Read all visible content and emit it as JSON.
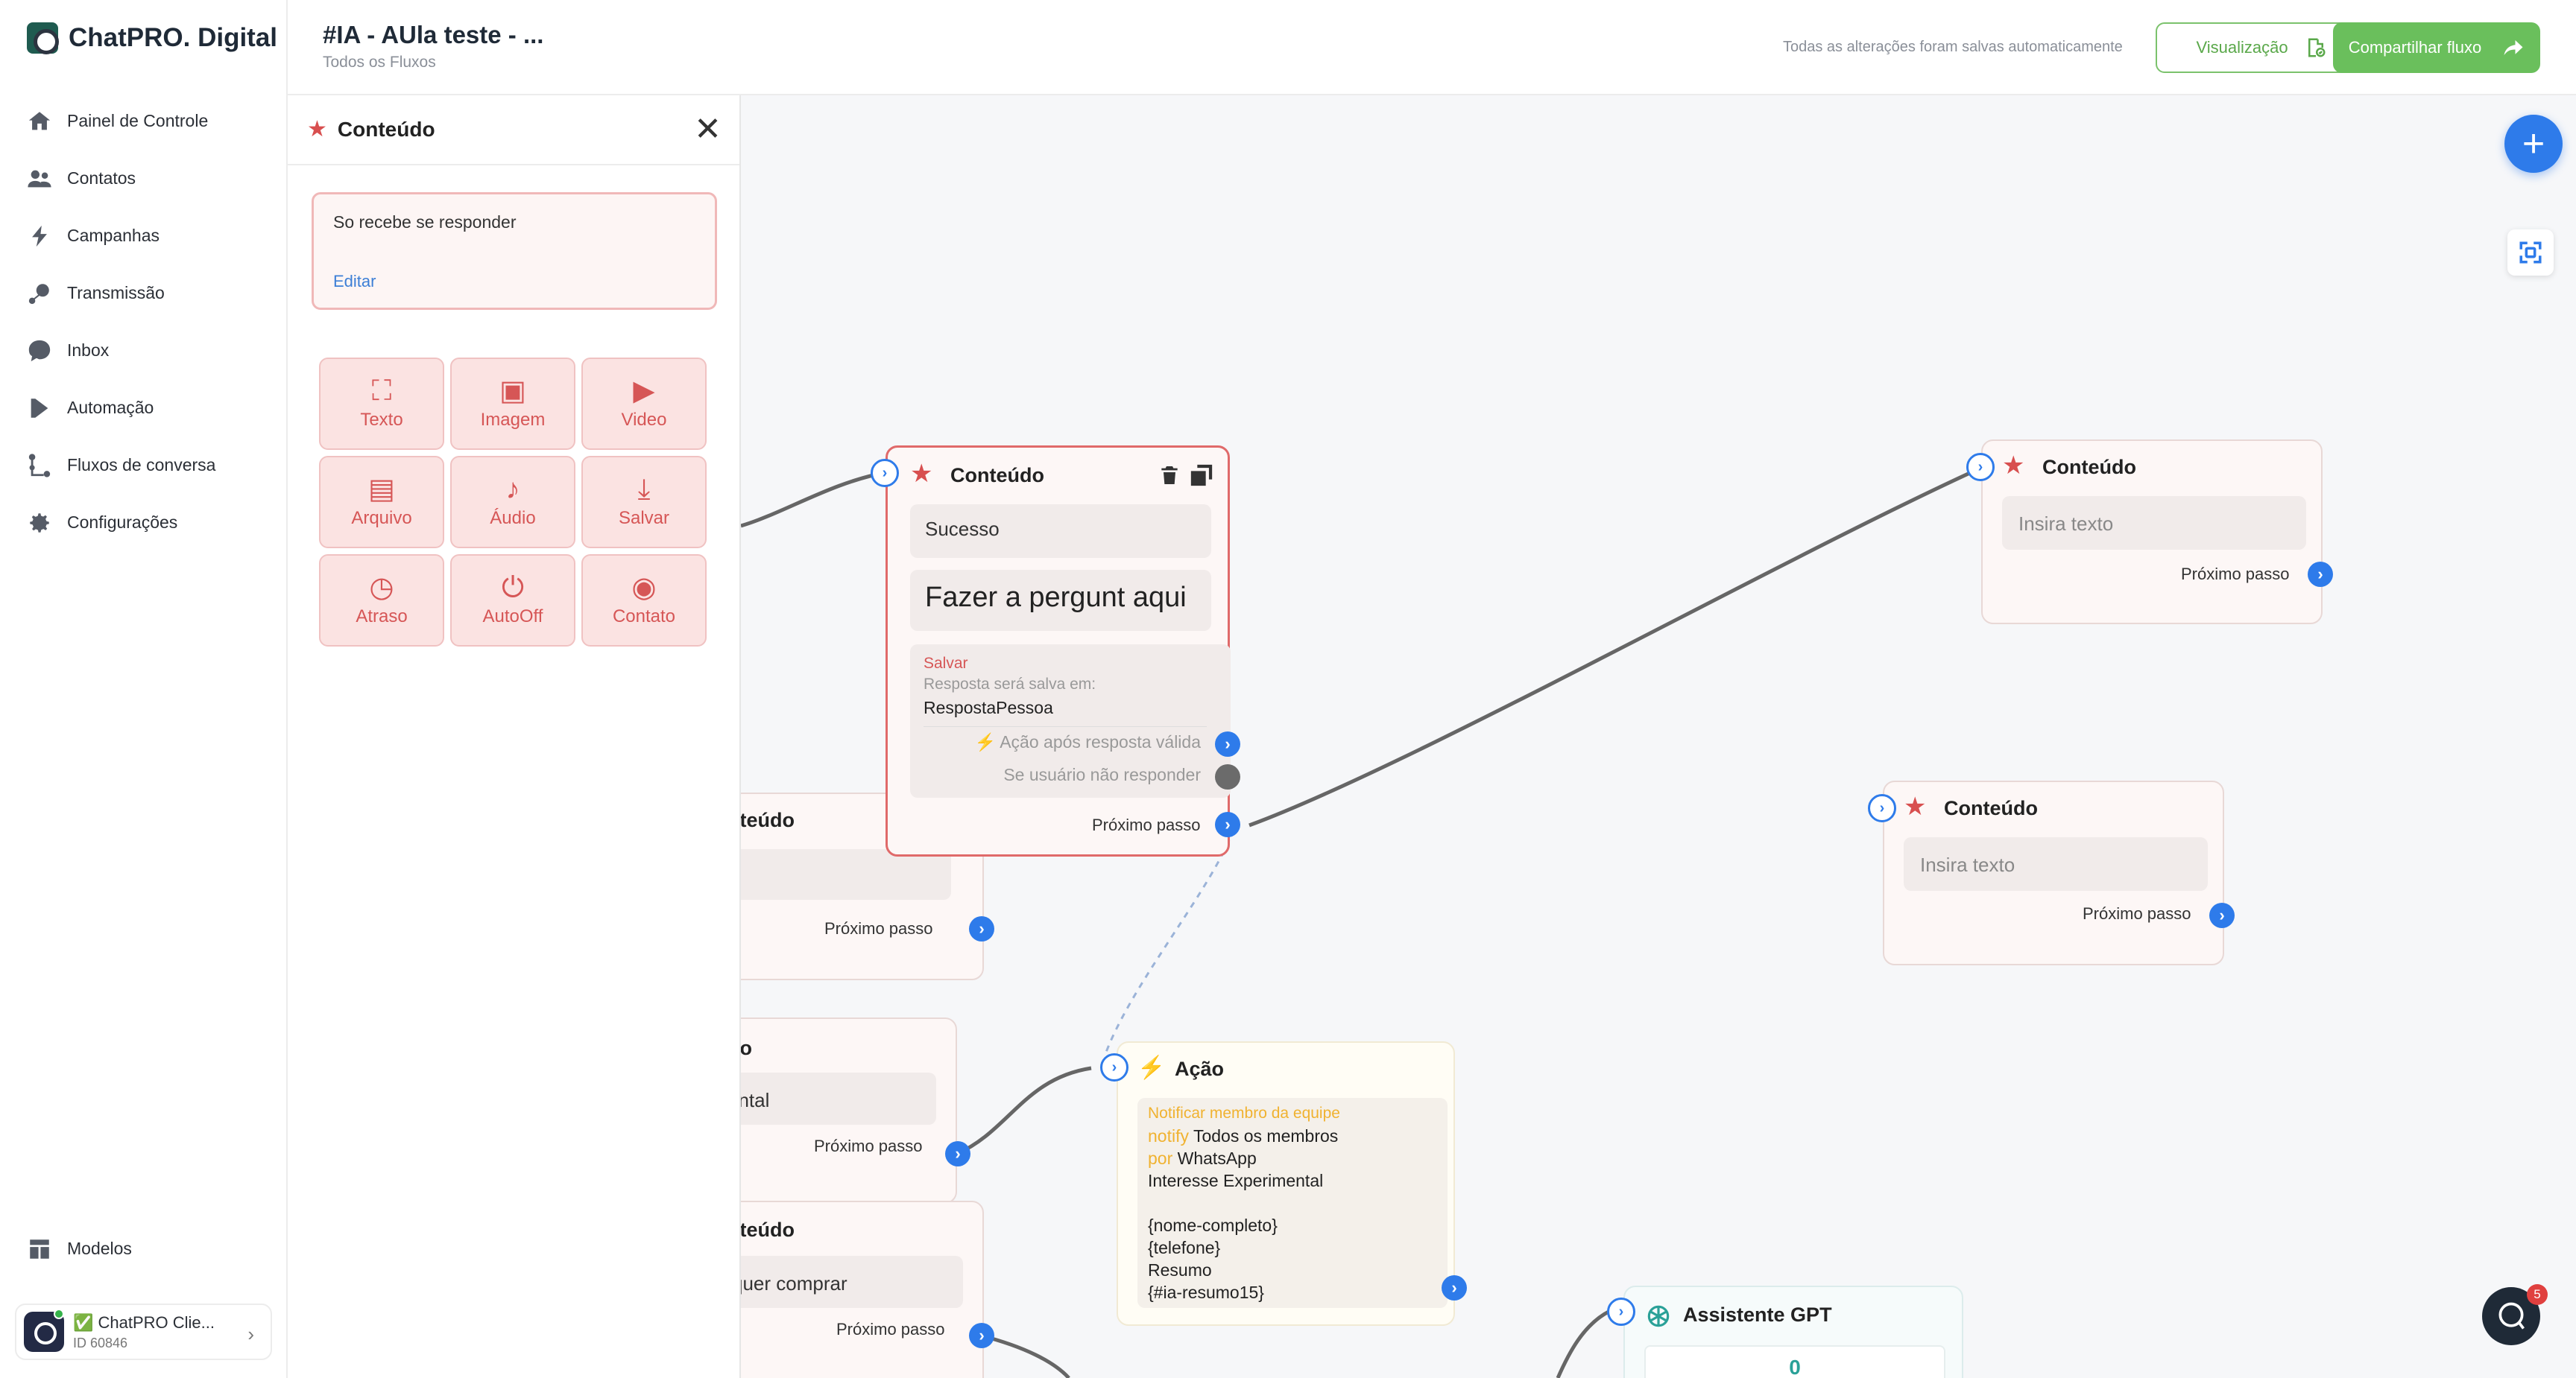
{
  "brand": {
    "name": "ChatPRO. Digital"
  },
  "nav": {
    "items": [
      {
        "label": "Painel de Controle",
        "icon": "home-icon"
      },
      {
        "label": "Contatos",
        "icon": "users-icon"
      },
      {
        "label": "Campanhas",
        "icon": "bolt-icon"
      },
      {
        "label": "Transmissão",
        "icon": "broadcast-icon"
      },
      {
        "label": "Inbox",
        "icon": "chat-icon"
      },
      {
        "label": "Automação",
        "icon": "play-icon"
      },
      {
        "label": "Fluxos de conversa",
        "icon": "flow-icon"
      },
      {
        "label": "Configurações",
        "icon": "gear-icon"
      }
    ],
    "bottom": {
      "label": "Modelos",
      "icon": "templates-icon"
    }
  },
  "account": {
    "name": "✅ ChatPRO Clie...",
    "id": "ID 60846"
  },
  "header": {
    "title": "#IA - AUla teste - ...",
    "breadcrumb": "Todos os Fluxos",
    "autosave": "Todas as alterações foram salvas automaticamente",
    "view_label": "Visualização",
    "share_label": "Compartilhar fluxo"
  },
  "panel": {
    "title": "Conteúdo",
    "message": "So recebe se responder",
    "edit_label": "Editar",
    "tiles": [
      {
        "label": "Texto",
        "icon": "text-icon"
      },
      {
        "label": "Imagem",
        "icon": "image-icon"
      },
      {
        "label": "Video",
        "icon": "video-icon"
      },
      {
        "label": "Arquivo",
        "icon": "file-icon"
      },
      {
        "label": "Áudio",
        "icon": "audio-icon"
      },
      {
        "label": "Salvar",
        "icon": "save-icon"
      },
      {
        "label": "Atraso",
        "icon": "delay-icon"
      },
      {
        "label": "AutoOff",
        "icon": "power-icon"
      },
      {
        "label": "Contato",
        "icon": "contact-icon"
      }
    ]
  },
  "canvas": {
    "main_node": {
      "title": "Conteúdo",
      "block1": "Sucesso",
      "block2": "Fazer a pergunt aqui",
      "save_label": "Salvar",
      "save_desc": "Resposta será salva em:",
      "save_var": "RespostaPessoa",
      "valid_action": "Ação após resposta válida",
      "no_reply": "Se usuário não responder",
      "next": "Próximo passo"
    },
    "node_tr": {
      "title": "Conteúdo",
      "placeholder": "Insira texto",
      "next": "Próximo passo"
    },
    "node_mr": {
      "title": "Conteúdo",
      "placeholder": "Insira texto",
      "next": "Próximo passo"
    },
    "partial_1": {
      "title": "nteúdo",
      "next": "Próximo passo"
    },
    "partial_2": {
      "title": "do",
      "text": "ental",
      "next": "Próximo passo"
    },
    "partial_3": {
      "title": "nteúdo",
      "text": "quer comprar",
      "next": "Próximo passo"
    },
    "action_node": {
      "title": "Ação",
      "heading": "Notificar membro da equipe",
      "notify_kw": "notify",
      "notify_val": "Todos os membros",
      "by_kw": "por",
      "by_val": "WhatsApp",
      "l1": "Interesse Experimental",
      "l2": "{nome-completo}",
      "l3": "{telefone}",
      "l4": "Resumo",
      "l5": "{#ia-resumo15}"
    },
    "gpt_node": {
      "title": "Assistente GPT",
      "value": "0"
    }
  },
  "help": {
    "badge": "5"
  },
  "colors": {
    "accent": "#2e7bea",
    "brand_green": "#6abf5c",
    "content_red": "#d84f4f",
    "action_yellow": "#f0a81e"
  }
}
